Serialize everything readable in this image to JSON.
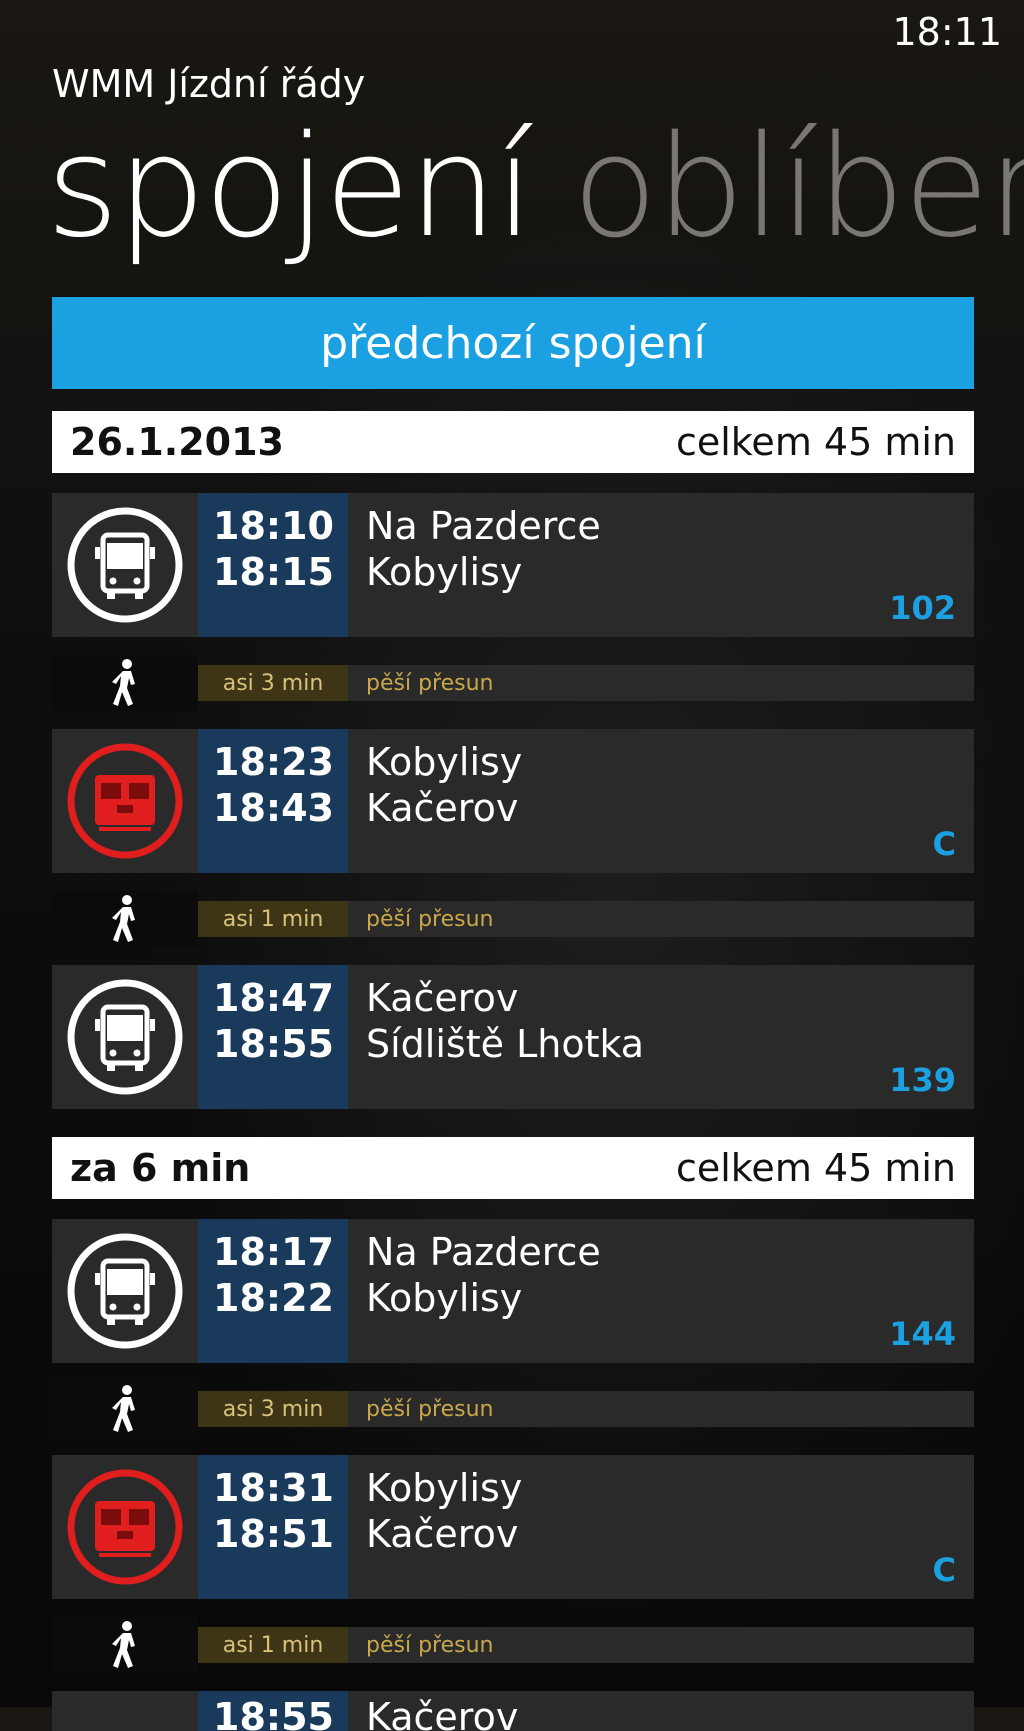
{
  "status": {
    "time": "18:11"
  },
  "app": {
    "title": "WMM Jízdní řády"
  },
  "pivot": {
    "active": "spojení",
    "inactive": "oblíben"
  },
  "prev_button": "předchozí spojení",
  "connections": [
    {
      "date_label": "26.1.2013",
      "total": "celkem 45 min",
      "segments": [
        {
          "mode": "bus",
          "dep": "18:10",
          "arr": "18:15",
          "from": "Na Pazderce",
          "to": "Kobylisy",
          "line": "102"
        },
        {
          "walk": "asi 3 min",
          "walk_label": "pěší přesun"
        },
        {
          "mode": "metro",
          "dep": "18:23",
          "arr": "18:43",
          "from": "Kobylisy",
          "to": "Kačerov",
          "line": "C"
        },
        {
          "walk": "asi 1 min",
          "walk_label": "pěší přesun"
        },
        {
          "mode": "bus",
          "dep": "18:47",
          "arr": "18:55",
          "from": "Kačerov",
          "to": "Sídliště Lhotka",
          "line": "139"
        }
      ]
    },
    {
      "date_label": "za 6 min",
      "total": "celkem 45 min",
      "segments": [
        {
          "mode": "bus",
          "dep": "18:17",
          "arr": "18:22",
          "from": "Na Pazderce",
          "to": "Kobylisy",
          "line": "144"
        },
        {
          "walk": "asi 3 min",
          "walk_label": "pěší přesun"
        },
        {
          "mode": "metro",
          "dep": "18:31",
          "arr": "18:51",
          "from": "Kobylisy",
          "to": "Kačerov",
          "line": "C"
        },
        {
          "walk": "asi 1 min",
          "walk_label": "pěší přesun"
        },
        {
          "mode": "bus",
          "dep": "18:55",
          "from": "Kačerov"
        }
      ]
    }
  ],
  "colors": {
    "accent": "#1ba1e2",
    "metro_red": "#e01e1e",
    "time_cell": "#1a3a5c"
  }
}
